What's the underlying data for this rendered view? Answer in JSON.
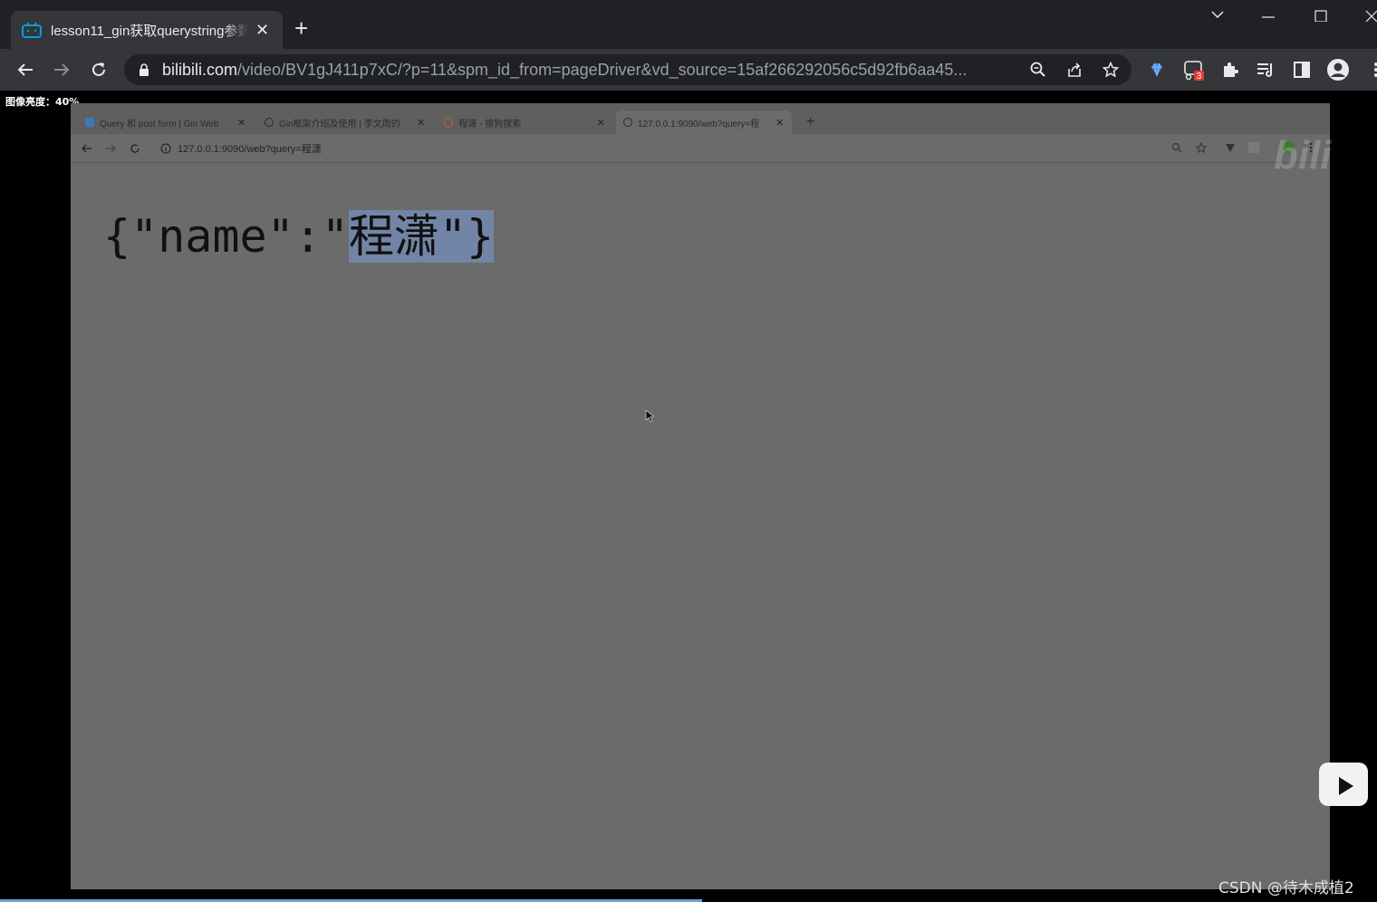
{
  "chrome": {
    "tab_title": "lesson11_gin获取querystring参数",
    "url_host": "bilibili.com",
    "url_path": "/video/BV1gJ411p7xC/?p=11&spm_id_from=pageDriver&vd_source=15af266292056c5d92fb6aa45...",
    "extension_badge": "3"
  },
  "video": {
    "brightness_label": "图像亮度：40%",
    "watermark": "CSDN @待木成植2",
    "progress_fraction": 0.51
  },
  "inner_browser": {
    "tabs": [
      {
        "label": "Query 和 post form | Gin Web"
      },
      {
        "label": "Gin框架介绍及使用 | 李文周的"
      },
      {
        "label": "程潇 - 搜狗搜索"
      },
      {
        "label": "127.0.0.1:9090/web?query=程"
      }
    ],
    "url": "127.0.0.1:9090/web?query=程潇",
    "json_prefix": "{\"name\":\"",
    "json_selected": "程潇\"}"
  }
}
